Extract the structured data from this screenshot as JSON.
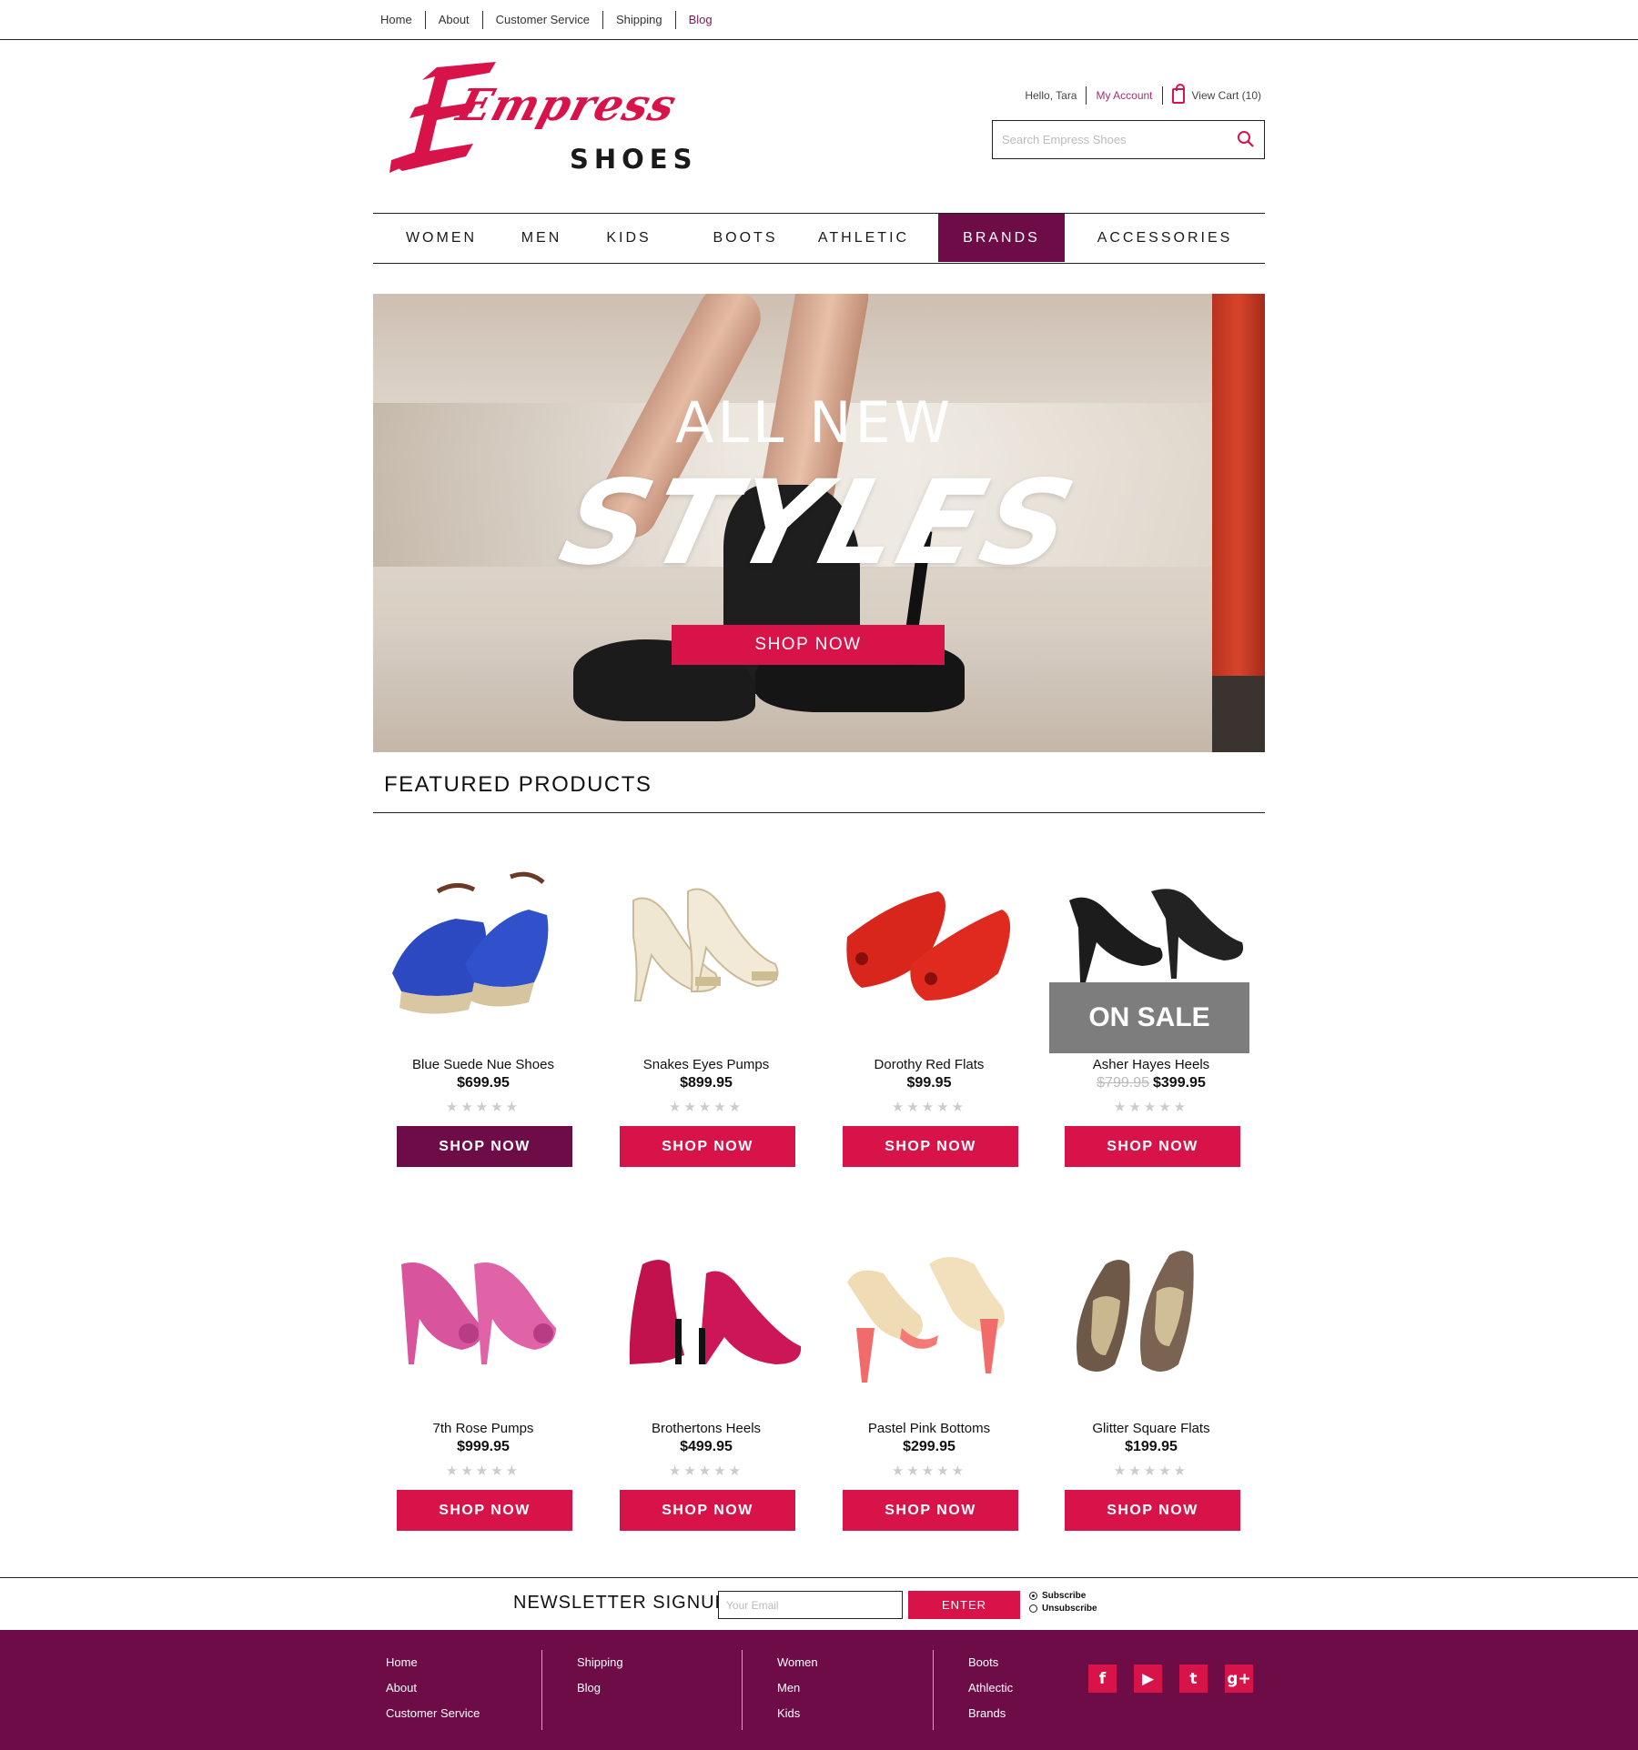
{
  "top_nav": {
    "items": [
      "Home",
      "About",
      "Customer Service",
      "Shipping",
      "Blog"
    ]
  },
  "logo": {
    "word": "Empress",
    "sub": "SHOES"
  },
  "account": {
    "greeting": "Hello, Tara",
    "my_account": "My Account",
    "cart": "View Cart (10)"
  },
  "search": {
    "placeholder": "Search Empress Shoes"
  },
  "main_nav": {
    "items": [
      "WOMEN",
      "MEN",
      "KIDS",
      "BOOTS",
      "ATHLETIC",
      "BRANDS",
      "ACCESSORIES"
    ],
    "active": "BRANDS"
  },
  "hero": {
    "line1": "ALL NEW",
    "line2": "STYLES",
    "button": "SHOP NOW"
  },
  "featured": {
    "title": "FEATURED PRODUCTS",
    "products": [
      {
        "name": "Blue Suede Nue Shoes",
        "price": "$699.95",
        "rating": 0,
        "button": "SHOP NOW"
      },
      {
        "name": "Snakes Eyes Pumps",
        "price": "$899.95",
        "rating": 0,
        "button": "SHOP NOW"
      },
      {
        "name": "Dorothy Red Flats",
        "price": "$99.95",
        "rating": 0,
        "button": "SHOP NOW"
      },
      {
        "name": "Asher Hayes Heels",
        "old_price": "$799.95",
        "price": "$399.95",
        "badge": "ON SALE",
        "rating": 0,
        "button": "SHOP NOW"
      },
      {
        "name": "7th Rose Pumps",
        "price": "$999.95",
        "rating": 0,
        "button": "SHOP NOW"
      },
      {
        "name": "Brothertons Heels",
        "price": "$499.95",
        "rating": 0,
        "button": "SHOP NOW"
      },
      {
        "name": "Pastel Pink Bottoms",
        "price": "$299.95",
        "rating": 0,
        "button": "SHOP NOW"
      },
      {
        "name": "Glitter Square Flats",
        "price": "$199.95",
        "rating": 0,
        "button": "SHOP NOW"
      }
    ],
    "stars": "★★★★★"
  },
  "newsletter": {
    "title": "NEWSLETTER SIGNUP",
    "placeholder": "Your Email",
    "button": "ENTER",
    "subscribe": "Subscribe",
    "unsubscribe": "Unsubscribe"
  },
  "footer": {
    "col1": [
      "Home",
      "About",
      "Customer Service"
    ],
    "col2": [
      "Shipping",
      "Blog"
    ],
    "col3": [
      "Women",
      "Men",
      "Kids"
    ],
    "col4": [
      "Boots",
      "Athlectic",
      "Brands"
    ],
    "social": [
      {
        "icon": "facebook-icon",
        "glyph": "f"
      },
      {
        "icon": "youtube-icon",
        "glyph": "▶"
      },
      {
        "icon": "twitter-icon",
        "glyph": "t"
      },
      {
        "icon": "google-plus-icon",
        "glyph": "g+"
      }
    ]
  },
  "colors": {
    "accent": "#d7134a",
    "brand_dark": "#6d0c47"
  }
}
